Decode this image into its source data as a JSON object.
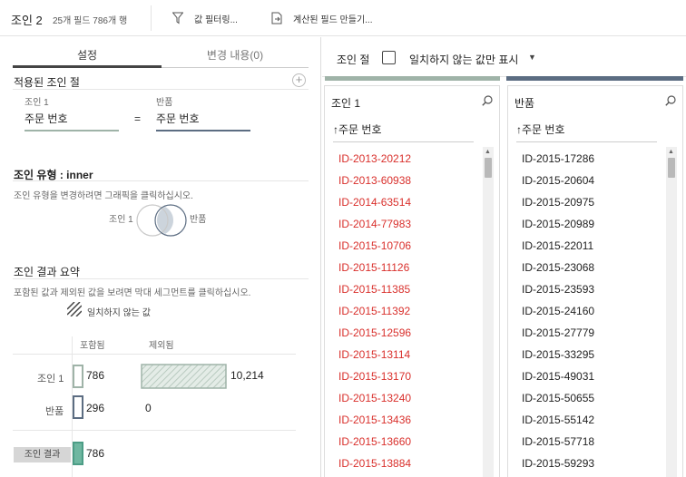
{
  "toolbar": {
    "title": "조인 2",
    "meta": "25개 필드  786개 행",
    "filter_label": "값 필터링...",
    "calc_label": "계산된 필드 만들기..."
  },
  "tabs": {
    "settings": "설정",
    "changes": "변경 내용(0)"
  },
  "applied": {
    "title": "적용된 조인 절",
    "left_source": "조인 1",
    "right_source": "반품",
    "left_field": "주문 번호",
    "operator": "=",
    "right_field": "주문 번호",
    "add_symbol": "+"
  },
  "join_type": {
    "title": "조인 유형 : inner",
    "hint": "조인 유형을 변경하려면 그래픽을 클릭하십시오.",
    "left_label": "조인 1",
    "right_label": "반품"
  },
  "summary": {
    "title": "조인 결과 요약",
    "hint": "포함된 값과 제외된 값을 보려면 막대 세그먼트를 클릭하십시오.",
    "legend_unmatched": "일치하지 않는 값",
    "col_included": "포함됨",
    "col_excluded": "제외됨",
    "rows": [
      {
        "label": "조인 1",
        "included": "786",
        "excluded": "10,214",
        "color": "#9fb3a8"
      },
      {
        "label": "반품",
        "included": "296",
        "excluded": "0",
        "color": "#5c6d82"
      }
    ],
    "result_label": "조인 결과",
    "result_value": "786",
    "result_color": "#6fb7a1"
  },
  "right_top": {
    "label": "조인 절",
    "toggle_label": "일치하지 않는 값만 표시"
  },
  "panels": [
    {
      "title": "조인 1",
      "column": "↑주문 번호",
      "bar_color": "#9fb3a8",
      "text_color": "#d9302c",
      "rows": [
        "ID-2013-20212",
        "ID-2013-60938",
        "ID-2014-63514",
        "ID-2014-77983",
        "ID-2015-10706",
        "ID-2015-11126",
        "ID-2015-11385",
        "ID-2015-11392",
        "ID-2015-12596",
        "ID-2015-13114",
        "ID-2015-13170",
        "ID-2015-13240",
        "ID-2015-13436",
        "ID-2015-13660",
        "ID-2015-13884"
      ]
    },
    {
      "title": "반품",
      "column": "↑주문 번호",
      "bar_color": "#5c6d82",
      "text_color": "#222222",
      "rows": [
        "ID-2015-17286",
        "ID-2015-20604",
        "ID-2015-20975",
        "ID-2015-20989",
        "ID-2015-22011",
        "ID-2015-23068",
        "ID-2015-23593",
        "ID-2015-24160",
        "ID-2015-27779",
        "ID-2015-33295",
        "ID-2015-49031",
        "ID-2015-50655",
        "ID-2015-55142",
        "ID-2015-57718",
        "ID-2015-59293"
      ]
    }
  ]
}
